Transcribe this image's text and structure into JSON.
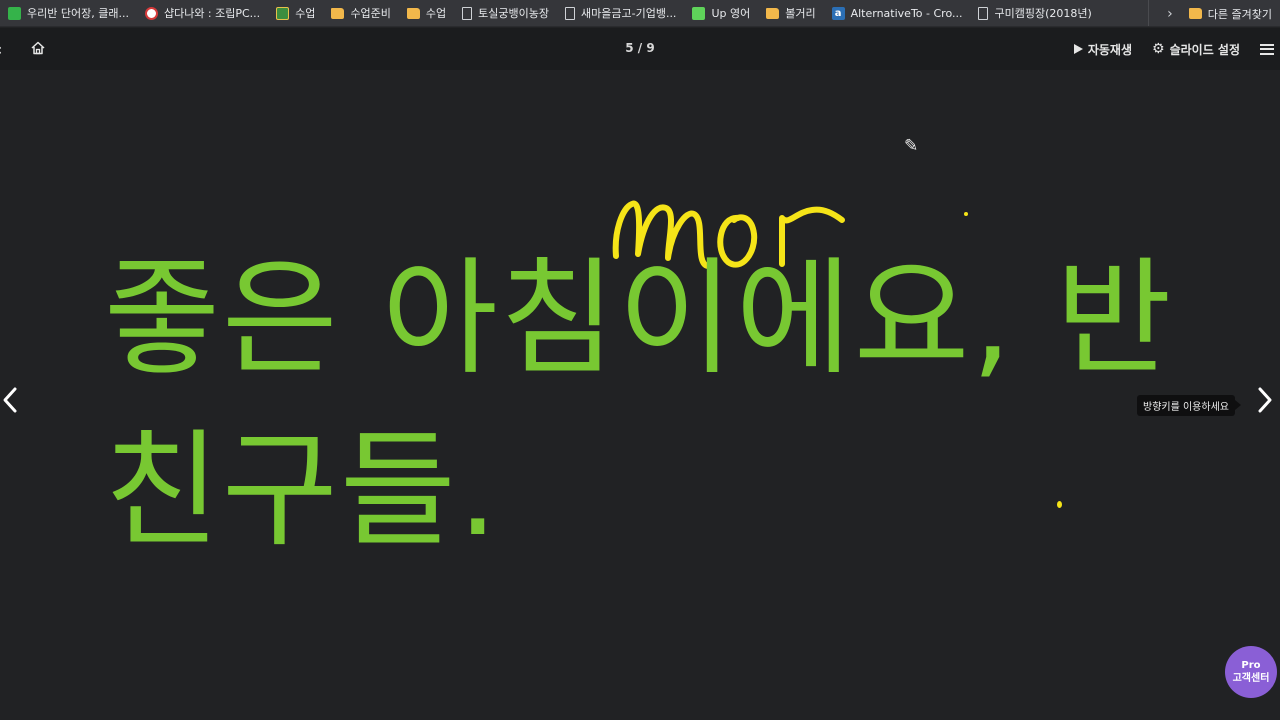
{
  "bookmarks": {
    "items": [
      {
        "label": "우리반 단어장, 클래...",
        "icon": "green-app-icon"
      },
      {
        "label": "샵다나와 : 조립PC...",
        "icon": "danawa-icon"
      },
      {
        "label": "수업",
        "icon": "image-icon"
      },
      {
        "label": "수업준비",
        "icon": "folder-icon"
      },
      {
        "label": "수업",
        "icon": "folder-icon"
      },
      {
        "label": "토실궁뱅이농장",
        "icon": "page-icon"
      },
      {
        "label": "새마을금고-기업뱅...",
        "icon": "page-icon"
      },
      {
        "label": "Up 영어",
        "icon": "line-icon"
      },
      {
        "label": "볼거리",
        "icon": "folder-icon"
      },
      {
        "label": "AlternativeTo - Cro...",
        "icon": "alternativeto-icon"
      },
      {
        "label": "구미캠핑장(2018년)",
        "icon": "page-icon"
      }
    ],
    "more_glyph": "›",
    "other": {
      "label": "다른 즐겨찾기",
      "icon": "folder-icon"
    }
  },
  "toolbar": {
    "back_glyph": "‹",
    "page_indicator": "5 / 9",
    "autoplay_label": "자동재생",
    "settings_label": "슬라이드 설정"
  },
  "slide": {
    "line1": "좋은 아침이에요, 반",
    "line2": "친구들.",
    "handwriting": "mor",
    "text_color": "#78c832",
    "ink_color": "#f5e418",
    "pen_cursor_glyph": "✎"
  },
  "nav": {
    "tooltip": "방향키를 이용하세요"
  },
  "pro_button": {
    "line1": "Pro",
    "line2": "고객센터"
  }
}
